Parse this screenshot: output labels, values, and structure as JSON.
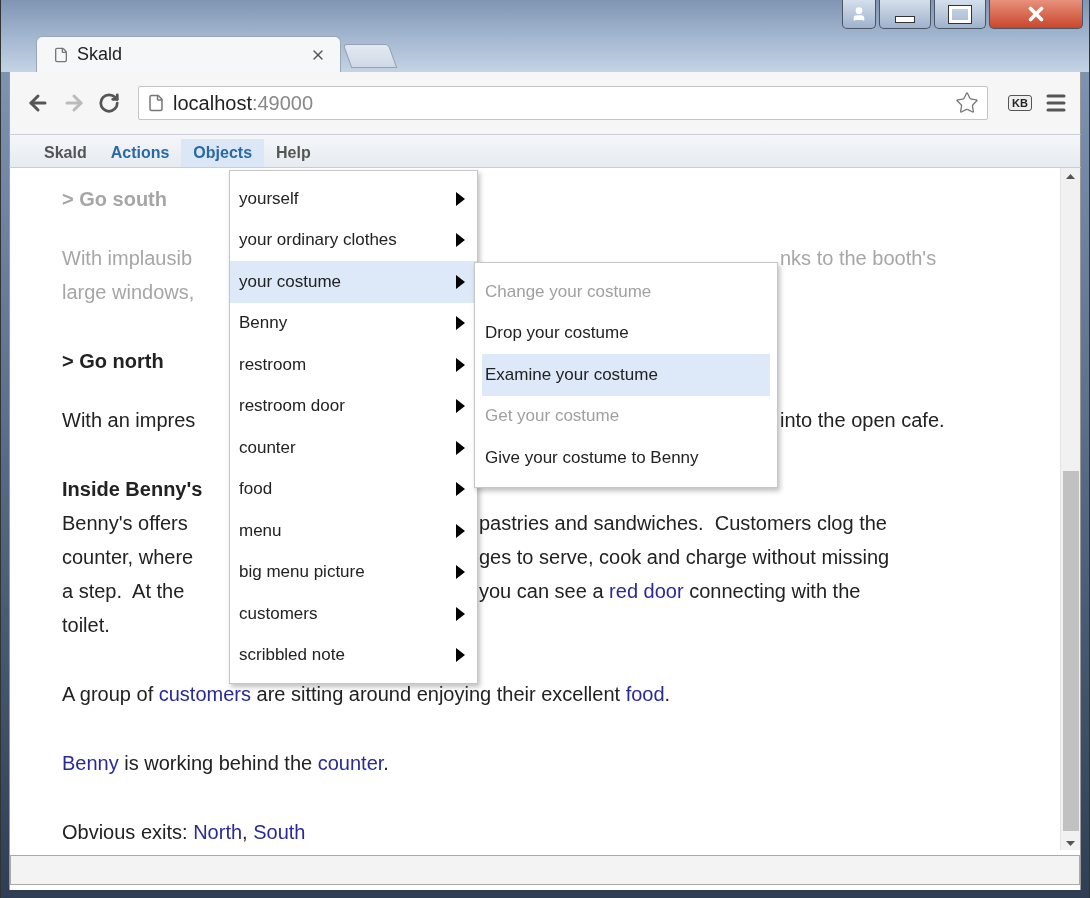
{
  "browser": {
    "tab_title": "Skald",
    "address": {
      "host": "localhost",
      "port": ":49000"
    },
    "extension_badge": "KB"
  },
  "menubar": [
    {
      "label": "Skald",
      "enabled": false,
      "selected": false
    },
    {
      "label": "Actions",
      "enabled": true,
      "selected": false
    },
    {
      "label": "Objects",
      "enabled": true,
      "selected": true
    },
    {
      "label": "Help",
      "enabled": false,
      "selected": false
    }
  ],
  "objects_menu": [
    {
      "label": "yourself",
      "selected": false
    },
    {
      "label": "your ordinary clothes",
      "selected": false
    },
    {
      "label": "your costume",
      "selected": true
    },
    {
      "label": "Benny",
      "selected": false
    },
    {
      "label": "restroom",
      "selected": false
    },
    {
      "label": "restroom door",
      "selected": false
    },
    {
      "label": "counter",
      "selected": false
    },
    {
      "label": "food",
      "selected": false
    },
    {
      "label": "menu",
      "selected": false
    },
    {
      "label": "big menu picture",
      "selected": false
    },
    {
      "label": "customers",
      "selected": false
    },
    {
      "label": "scribbled note",
      "selected": false
    }
  ],
  "submenu": [
    {
      "label": "Change your costume",
      "disabled": true,
      "selected": false
    },
    {
      "label": "Drop your costume",
      "disabled": false,
      "selected": false
    },
    {
      "label": "Examine your costume",
      "disabled": false,
      "selected": true
    },
    {
      "label": "Get your costume",
      "disabled": true,
      "selected": false
    },
    {
      "label": "Give your costume to Benny",
      "disabled": false,
      "selected": false
    }
  ],
  "story": [
    {
      "kind": "command",
      "faded": true,
      "lines": [
        {
          "kind": "full",
          "left": [
            {
              "text": "> Go south",
              "link": false
            }
          ]
        }
      ]
    },
    {
      "kind": "paragraph",
      "faded": true,
      "lines": [
        {
          "kind": "submenu_gap",
          "left": [
            {
              "text": "With implausib",
              "link": false
            }
          ],
          "right": [
            {
              "text": "nks to the booth's",
              "link": false
            }
          ]
        },
        {
          "kind": "full",
          "left": [
            {
              "text": "large windows,",
              "link": false
            }
          ]
        }
      ]
    },
    {
      "kind": "command",
      "faded": false,
      "lines": [
        {
          "kind": "full",
          "left": [
            {
              "text": "> Go north",
              "link": false
            }
          ]
        }
      ]
    },
    {
      "kind": "paragraph",
      "faded": false,
      "lines": [
        {
          "kind": "submenu_gap",
          "left": [
            {
              "text": "With an impres",
              "link": false
            }
          ],
          "right": [
            {
              "text": "into the open cafe.",
              "link": false
            }
          ]
        }
      ]
    },
    {
      "kind": "heading",
      "faded": false,
      "lines": [
        {
          "kind": "full",
          "left": [
            {
              "text": "Inside Benny's",
              "link": false
            }
          ]
        }
      ]
    },
    {
      "kind": "paragraph",
      "faded": false,
      "lines": [
        {
          "kind": "menu_gap",
          "left": [
            {
              "text": "Benny's offers",
              "link": false
            }
          ],
          "right": [
            {
              "text": "pastries and sandwiches.  Customers clog the",
              "link": false
            }
          ]
        },
        {
          "kind": "menu_gap",
          "left": [
            {
              "text": "counter, where",
              "link": false
            }
          ],
          "right": [
            {
              "text": "ges to serve, cook and charge without missing",
              "link": false
            }
          ]
        },
        {
          "kind": "menu_gap",
          "left": [
            {
              "text": "a step.  At the",
              "link": false
            }
          ],
          "right": [
            {
              "text": "you can see a ",
              "link": false
            },
            {
              "text": "red door",
              "link": true
            },
            {
              "text": " connecting with the",
              "link": false
            }
          ]
        },
        {
          "kind": "full",
          "left": [
            {
              "text": "toilet.",
              "link": false
            }
          ]
        }
      ]
    },
    {
      "kind": "paragraph",
      "faded": false,
      "lines": [
        {
          "kind": "full",
          "left": [
            {
              "text": "A group of ",
              "link": false
            },
            {
              "text": "customers",
              "link": true
            },
            {
              "text": " are sitting around enjoying their excellent ",
              "link": false
            },
            {
              "text": "food",
              "link": true
            },
            {
              "text": ".",
              "link": false
            }
          ]
        }
      ]
    },
    {
      "kind": "paragraph",
      "faded": false,
      "lines": [
        {
          "kind": "full",
          "left": [
            {
              "text": "Benny",
              "link": true
            },
            {
              "text": " is working behind the ",
              "link": false
            },
            {
              "text": "counter",
              "link": true
            },
            {
              "text": ".",
              "link": false
            }
          ]
        }
      ]
    },
    {
      "kind": "paragraph",
      "faded": false,
      "lines": [
        {
          "kind": "full",
          "left": [
            {
              "text": "Obvious exits: ",
              "link": false
            },
            {
              "text": "North",
              "link": true
            },
            {
              "text": ", ",
              "link": false
            },
            {
              "text": "South",
              "link": true
            }
          ]
        }
      ]
    }
  ]
}
